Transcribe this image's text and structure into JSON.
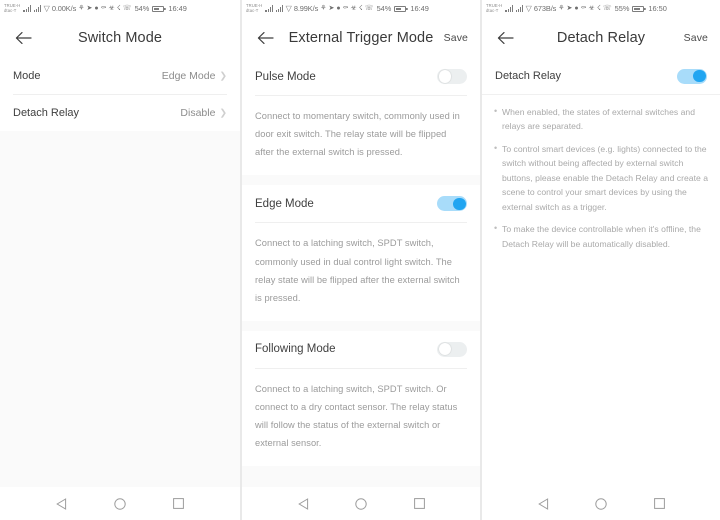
{
  "statusbar": {
    "carrier_line1": "TRUE-H",
    "carrier_line2": "dtac-T",
    "screen1": {
      "speed": "0.00K/s",
      "battery": "54%",
      "time": "16:49"
    },
    "screen2": {
      "speed": "8.99K/s",
      "battery": "54%",
      "time": "16:49"
    },
    "screen3": {
      "speed": "673B/s",
      "battery": "55%",
      "time": "16:50"
    },
    "tray_icons": [
      "vpn-icon",
      "telegram-icon",
      "facebook-icon",
      "key-icon",
      "bug-icon",
      "bluetooth-icon",
      "call-icon"
    ]
  },
  "colors": {
    "toggle_on_track": "#a8dcfa",
    "toggle_on_knob": "#21a5f1",
    "toggle_off_track": "#eceff0",
    "page_background": "#fafafa",
    "card_background": "#ffffff"
  },
  "screen1": {
    "title": "Switch Mode",
    "back_label": "Back",
    "rows": [
      {
        "label": "Mode",
        "value": "Edge Mode"
      },
      {
        "label": "Detach Relay",
        "value": "Disable"
      }
    ]
  },
  "screen2": {
    "title": "External Trigger Mode",
    "save_label": "Save",
    "modes": [
      {
        "name": "Pulse Mode",
        "enabled": false,
        "description": "Connect to momentary switch, commonly used in door exit switch. The relay state will be flipped after the external switch is pressed."
      },
      {
        "name": "Edge Mode",
        "enabled": true,
        "description": "Connect to a latching switch, SPDT switch, commonly used in dual control light switch. The relay state will be flipped after the external switch is pressed."
      },
      {
        "name": "Following Mode",
        "enabled": false,
        "description": "Connect to a latching switch, SPDT switch. Or connect to a dry contact sensor. The relay status will follow the status of the external switch or external sensor."
      }
    ]
  },
  "screen3": {
    "title": "Detach Relay",
    "save_label": "Save",
    "row": {
      "label": "Detach Relay",
      "enabled": true
    },
    "notes": [
      "When enabled, the states of external switches and relays are separated.",
      "To control smart devices (e.g. lights) connected to the switch without being affected by external switch buttons, please enable the Detach Relay and create a scene to control your smart devices by using the external switch as a trigger.",
      "To make the device controllable when it's offline, the Detach Relay will be automatically disabled."
    ]
  },
  "navbar": {
    "back": "back-triangle-icon",
    "home": "home-circle-icon",
    "recents": "recents-square-icon"
  }
}
